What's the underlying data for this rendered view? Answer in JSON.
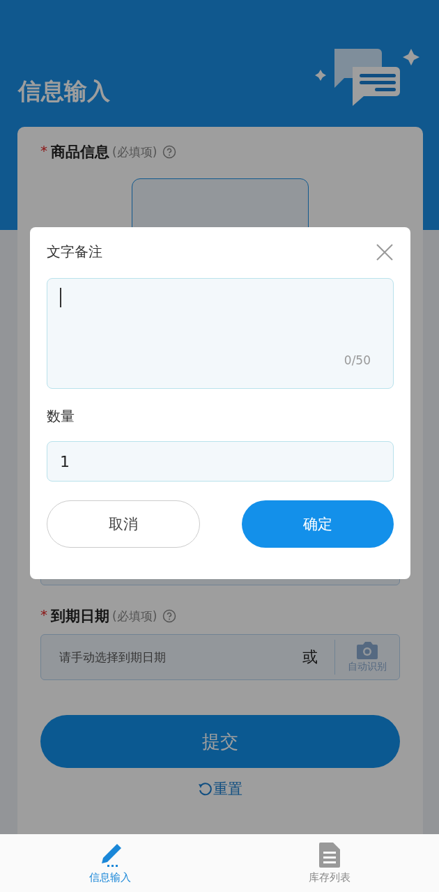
{
  "header": {
    "title": "信息输入"
  },
  "product_section": {
    "required_mark": "*",
    "label": "商品信息",
    "hint": "(必填项)"
  },
  "expiry_section": {
    "required_mark": "*",
    "label": "到期日期",
    "hint": "(必填项)",
    "placeholder": "请手动选择到期日期",
    "or_text": "或",
    "auto_button": "自动识别"
  },
  "submit_button": "提交",
  "reset_button": "重置",
  "dialog": {
    "title": "文字备注",
    "note_counter": "0/50",
    "quantity_label": "数量",
    "quantity_value": "1",
    "cancel_button": "取消",
    "confirm_button": "确定"
  },
  "nav": [
    {
      "label": "信息输入",
      "selected": true,
      "kind": "edit"
    },
    {
      "label": "库存列表",
      "selected": false,
      "kind": "list"
    }
  ]
}
